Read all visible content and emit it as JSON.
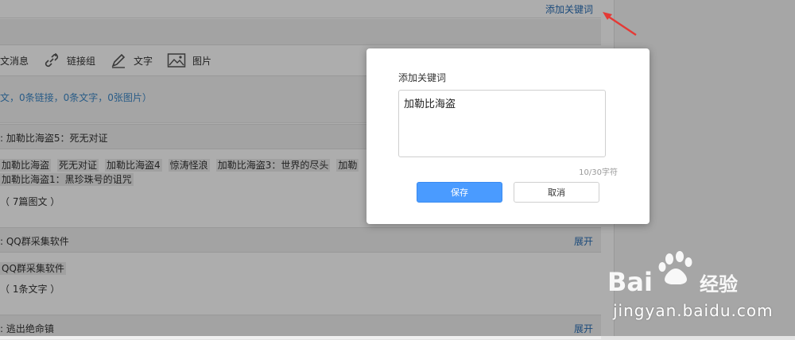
{
  "header": {
    "add_keyword_link": "添加关键词"
  },
  "toolbar": {
    "items": [
      {
        "label": "文消息",
        "icon": "news-icon"
      },
      {
        "label": "链接组",
        "icon": "link-icon"
      },
      {
        "label": "文字",
        "icon": "pen-icon"
      },
      {
        "label": "图片",
        "icon": "image-icon"
      }
    ]
  },
  "summary": {
    "text": "文，0条链接，0条文字，0张图片）"
  },
  "groups": [
    {
      "title": ": 加勒比海盗5：死无对证",
      "keywords": [
        "加勒比海盗",
        "死无对证",
        "加勒比海盗4",
        "惊涛怪浪",
        "加勒比海盗3：世界的尽头",
        "加勒"
      ],
      "keywords_line2": "加勒比海盗1：黑珍珠号的诅咒",
      "count": "（ 7篇图文 ）"
    },
    {
      "title": ": QQ群采集软件",
      "expand": "展开",
      "keyword": "QQ群采集软件",
      "count": "（ 1条文字 ）"
    },
    {
      "title": ": 逃出绝命镇",
      "expand": "展开"
    }
  ],
  "modal": {
    "title": "添加关键词",
    "textarea_value": "加勒比海盗",
    "char_count": "10/30字符",
    "save_label": "保存",
    "cancel_label": "取消",
    "save_color": "#4a9bff"
  },
  "watermark": {
    "brand": "Bai 经验",
    "url": "jingyan.baidu.com"
  }
}
